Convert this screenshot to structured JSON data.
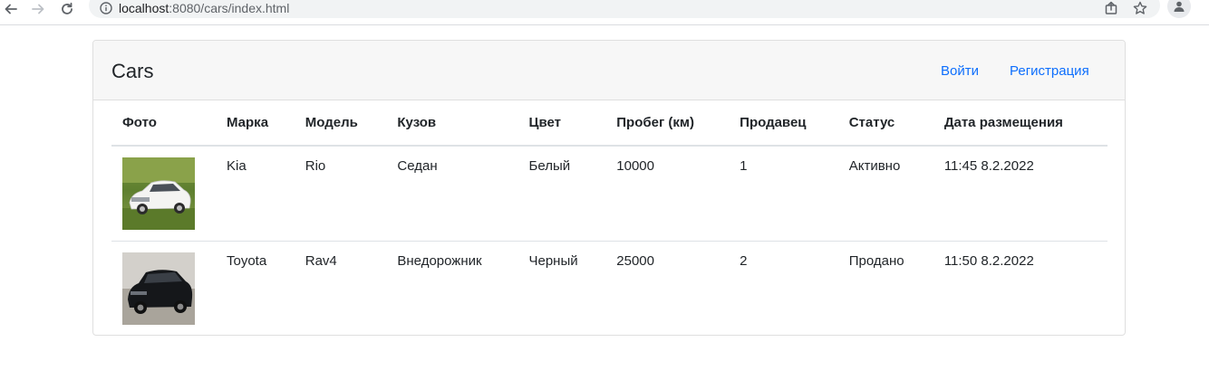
{
  "browser": {
    "url_host": "localhost",
    "url_path": ":8080/cars/index.html"
  },
  "header": {
    "brand": "Cars",
    "login": "Войти",
    "register": "Регистрация"
  },
  "table": {
    "columns": [
      "Фото",
      "Марка",
      "Модель",
      "Кузов",
      "Цвет",
      "Пробег (км)",
      "Продавец",
      "Статус",
      "Дата размещения"
    ],
    "rows": [
      {
        "make": "Kia",
        "model": "Rio",
        "body": "Седан",
        "color": "Белый",
        "mileage": "10000",
        "seller": "1",
        "status": "Активно",
        "date": "11:45 8.2.2022"
      },
      {
        "make": "Toyota",
        "model": "Rav4",
        "body": "Внедорожник",
        "color": "Черный",
        "mileage": "25000",
        "seller": "2",
        "status": "Продано",
        "date": "11:50 8.2.2022"
      }
    ]
  }
}
